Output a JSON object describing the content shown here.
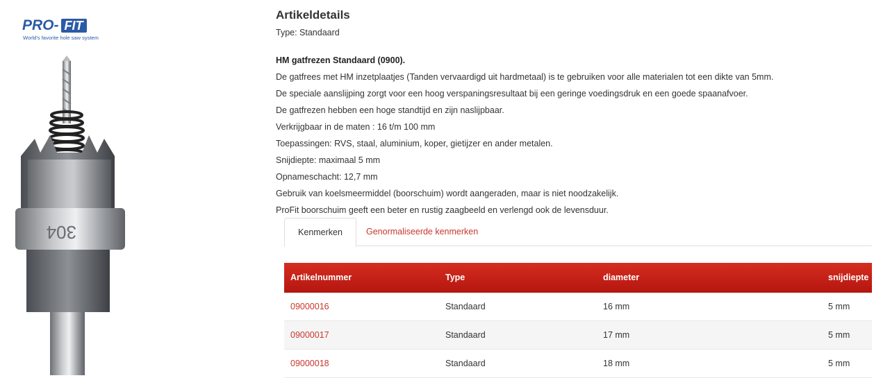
{
  "brand": {
    "logo_pro": "PRO-",
    "logo_fit": "FIT",
    "tagline": "World's favorite hole saw system",
    "primary_color": "#2b5aa8"
  },
  "article": {
    "title": "Artikeldetails",
    "type_line": "Type: Standaard",
    "heading": "HM gatfrezen Standaard (0900).",
    "lines": [
      "De gatfrees met HM  inzetplaatjes (Tanden vervaardigd uit hardmetaal) is te gebruiken voor alle materialen tot een dikte van 5mm.",
      "De speciale aanslijping zorgt voor een hoog verspaningsresultaat bij een geringe voedingsdruk en een goede spaanafvoer.",
      "De gatfrezen hebben een hoge standtijd en zijn naslijpbaar.",
      "Verkrijgbaar in de maten : 16 t/m 100 mm",
      "Toepassingen: RVS, staal, aluminium, koper, gietijzer en ander metalen.",
      "Snijdiepte: maximaal 5 mm",
      "Opnameschacht: 12,7 mm",
      "Gebruik van koelsmeermiddel (boorschuim) wordt aangeraden, maar is niet noodzakelijk.",
      "ProFit boorschuim geeft een beter en rustig zaagbeeld en verlengd ook de levensduur."
    ]
  },
  "tabs": [
    {
      "label": "Kenmerken",
      "active": true
    },
    {
      "label": "Genormaliseerde kenmerken",
      "active": false
    }
  ],
  "table": {
    "headers": [
      "Artikelnummer",
      "Type",
      "diameter",
      "snijdiepte"
    ],
    "rows": [
      [
        "09000016",
        "Standaard",
        "16 mm",
        "5 mm"
      ],
      [
        "09000017",
        "Standaard",
        "17 mm",
        "5 mm"
      ],
      [
        "09000018",
        "Standaard",
        "18 mm",
        "5 mm"
      ]
    ],
    "header_color": "#c92218",
    "link_color": "#c8372d"
  }
}
